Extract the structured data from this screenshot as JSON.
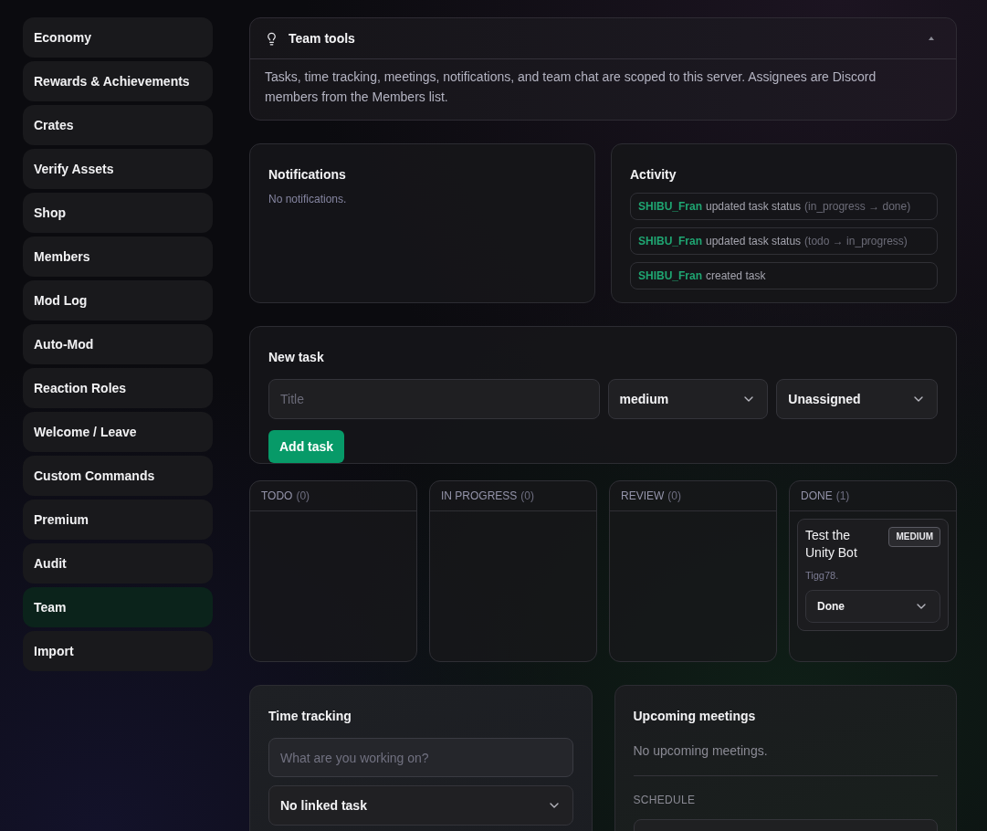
{
  "sidebar": {
    "items": [
      {
        "label": "Economy",
        "selected": false
      },
      {
        "label": "Rewards & Achievements",
        "selected": false
      },
      {
        "label": "Crates",
        "selected": false
      },
      {
        "label": "Verify Assets",
        "selected": false
      },
      {
        "label": "Shop",
        "selected": false
      },
      {
        "label": "Members",
        "selected": false
      },
      {
        "label": "Mod Log",
        "selected": false
      },
      {
        "label": "Auto-Mod",
        "selected": false
      },
      {
        "label": "Reaction Roles",
        "selected": false
      },
      {
        "label": "Welcome / Leave",
        "selected": false
      },
      {
        "label": "Custom Commands",
        "selected": false
      },
      {
        "label": "Premium",
        "selected": false
      },
      {
        "label": "Audit",
        "selected": false
      },
      {
        "label": "Team",
        "selected": true
      },
      {
        "label": "Import",
        "selected": false
      }
    ]
  },
  "team_tools": {
    "title": "Team tools",
    "expanded": true,
    "description": "Tasks, time tracking, meetings, notifications, and team chat are scoped to this server. Assignees are Discord members from the Members list."
  },
  "notifications": {
    "title": "Notifications",
    "empty_text": "No notifications."
  },
  "activity": {
    "title": "Activity",
    "entries": [
      {
        "user": "SHIBU_Fran",
        "action": "updated task status",
        "detail": "(in_progress → done)"
      },
      {
        "user": "SHIBU_Fran",
        "action": "updated task status",
        "detail": "(todo → in_progress)"
      },
      {
        "user": "SHIBU_Fran",
        "action": "created task"
      }
    ]
  },
  "new_task": {
    "title": "New task",
    "title_field": {
      "placeholder": "Title"
    },
    "priority_select": {
      "value": "medium"
    },
    "assignee_select": {
      "value": "Unassigned"
    },
    "submit_button": "Add task"
  },
  "board": {
    "columns": [
      {
        "name": "TODO",
        "count": "(0)"
      },
      {
        "name": "IN PROGRESS",
        "count": "(0)"
      },
      {
        "name": "REVIEW",
        "count": "(0)"
      },
      {
        "name": "DONE",
        "count": "(1)",
        "tasks": [
          {
            "title": "Test the Unity Bot",
            "priority": "MEDIUM",
            "assignee": "Tigg78.",
            "status": "Done"
          }
        ]
      }
    ]
  },
  "time_tracking": {
    "title": "Time tracking",
    "task_field": {
      "placeholder": "What are you working on?"
    },
    "linked_task_select": {
      "value": "No linked task"
    }
  },
  "meetings": {
    "title": "Upcoming meetings",
    "empty_text": "No upcoming meetings.",
    "schedule_heading": "SCHEDULE"
  }
}
